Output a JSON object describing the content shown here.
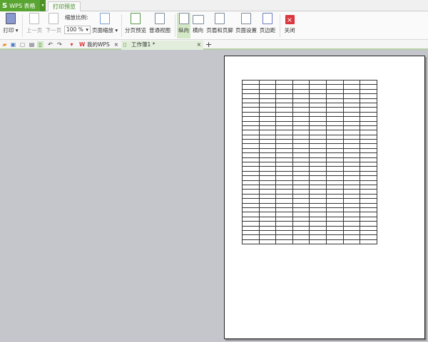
{
  "app": {
    "name": "WPS 表格",
    "logo": "S"
  },
  "tabs": [
    {
      "label": "打印预览"
    }
  ],
  "ribbon": {
    "print": "打印 ▾",
    "prev_page": "上一页",
    "next_page": "下一页",
    "zoom_label": "缩放比例:",
    "zoom_value": "100 %",
    "page_zoom": "页面缩放 ▾",
    "page_break_preview": "分页预览",
    "normal_view": "普通视图",
    "portrait": "纵向",
    "landscape": "横向",
    "header_footer": "页眉和页脚",
    "page_setup": "页面设置",
    "margins": "页边距",
    "close": "关闭"
  },
  "doc_tabs": [
    {
      "label": "我的WPS"
    },
    {
      "label": "工作簿1 *"
    }
  ],
  "colors": {
    "accent": "#5aa532",
    "close": "#d9363e"
  }
}
